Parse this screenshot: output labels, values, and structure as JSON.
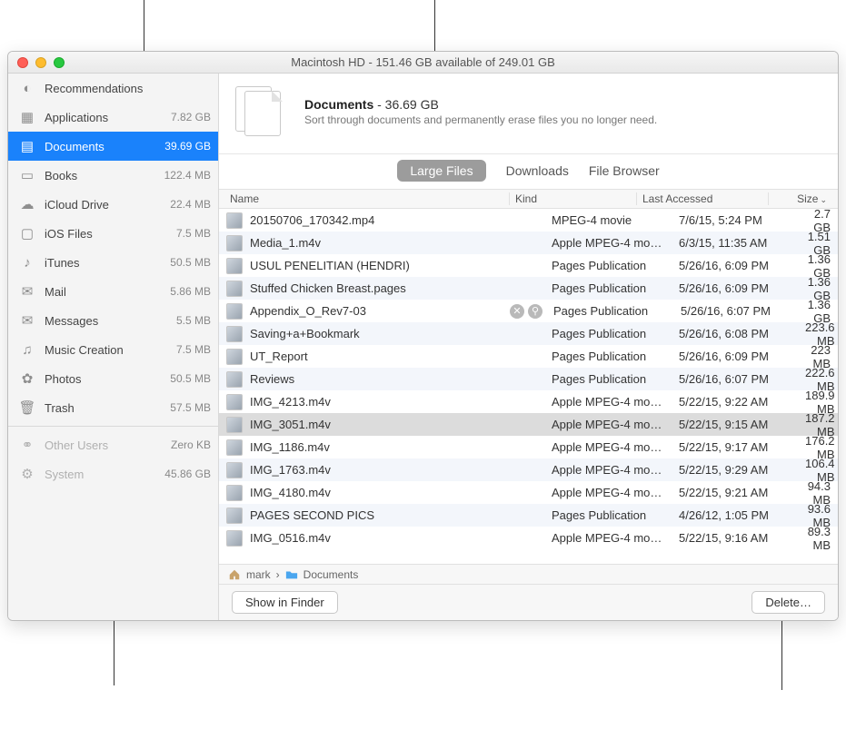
{
  "title": "Macintosh HD - 151.46 GB available of 249.01 GB",
  "sidebar": [
    {
      "icon": "lightbulb",
      "label": "Recommendations",
      "size": "",
      "dim": false
    },
    {
      "icon": "grid",
      "label": "Applications",
      "size": "7.82 GB"
    },
    {
      "icon": "doc",
      "label": "Documents",
      "size": "39.69 GB",
      "selected": true
    },
    {
      "icon": "book",
      "label": "Books",
      "size": "122.4 MB"
    },
    {
      "icon": "cloud",
      "label": "iCloud Drive",
      "size": "22.4 MB"
    },
    {
      "icon": "phone",
      "label": "iOS Files",
      "size": "7.5 MB"
    },
    {
      "icon": "note",
      "label": "iTunes",
      "size": "50.5 MB"
    },
    {
      "icon": "mail",
      "label": "Mail",
      "size": "5.86 MB"
    },
    {
      "icon": "bubble",
      "label": "Messages",
      "size": "5.5 MB"
    },
    {
      "icon": "music",
      "label": "Music Creation",
      "size": "7.5 MB"
    },
    {
      "icon": "flower",
      "label": "Photos",
      "size": "50.5 MB"
    },
    {
      "icon": "trash",
      "label": "Trash",
      "size": "57.5 MB"
    },
    {
      "sep": true
    },
    {
      "icon": "users",
      "label": "Other Users",
      "size": "Zero KB",
      "dim": true
    },
    {
      "icon": "gear",
      "label": "System",
      "size": "45.86 GB",
      "dim": true
    }
  ],
  "header": {
    "title_strong": "Documents",
    "title_rest": " - 36.69 GB",
    "subtitle": "Sort through documents and permanently erase files you no longer need."
  },
  "tabs": {
    "active": "Large Files",
    "t1": "Downloads",
    "t2": "File Browser"
  },
  "columns": {
    "name": "Name",
    "kind": "Kind",
    "date": "Last Accessed",
    "size": "Size"
  },
  "files": [
    {
      "name": "20150706_170342.mp4",
      "kind": "MPEG-4 movie",
      "date": "7/6/15, 5:24 PM",
      "size": "2.7 GB"
    },
    {
      "name": "Media_1.m4v",
      "kind": "Apple MPEG-4 mo…",
      "date": "6/3/15, 11:35 AM",
      "size": "1.51 GB"
    },
    {
      "name": "USUL PENELITIAN (HENDRI)",
      "kind": "Pages Publication",
      "date": "5/26/16, 6:09 PM",
      "size": "1.36 GB"
    },
    {
      "name": "Stuffed Chicken Breast.pages",
      "kind": "Pages Publication",
      "date": "5/26/16, 6:09 PM",
      "size": "1.36 GB"
    },
    {
      "name": "Appendix_O_Rev7-03",
      "kind": "Pages Publication",
      "date": "5/26/16, 6:07 PM",
      "size": "1.36 GB",
      "hover": true
    },
    {
      "name": "Saving+a+Bookmark",
      "kind": "Pages Publication",
      "date": "5/26/16, 6:08 PM",
      "size": "223.6 MB"
    },
    {
      "name": "UT_Report",
      "kind": "Pages Publication",
      "date": "5/26/16, 6:09 PM",
      "size": "223 MB"
    },
    {
      "name": "Reviews",
      "kind": "Pages Publication",
      "date": "5/26/16, 6:07 PM",
      "size": "222.6 MB"
    },
    {
      "name": "IMG_4213.m4v",
      "kind": "Apple MPEG-4 mo…",
      "date": "5/22/15, 9:22 AM",
      "size": "189.9 MB"
    },
    {
      "name": "IMG_3051.m4v",
      "kind": "Apple MPEG-4 mo…",
      "date": "5/22/15, 9:15 AM",
      "size": "187.2 MB",
      "selected": true
    },
    {
      "name": "IMG_1186.m4v",
      "kind": "Apple MPEG-4 mo…",
      "date": "5/22/15, 9:17 AM",
      "size": "176.2 MB"
    },
    {
      "name": "IMG_1763.m4v",
      "kind": "Apple MPEG-4 mo…",
      "date": "5/22/15, 9:29 AM",
      "size": "106.4 MB"
    },
    {
      "name": "IMG_4180.m4v",
      "kind": "Apple MPEG-4 mo…",
      "date": "5/22/15, 9:21 AM",
      "size": "94.3 MB"
    },
    {
      "name": "PAGES SECOND PICS",
      "kind": "Pages Publication",
      "date": "4/26/12, 1:05 PM",
      "size": "93.6 MB"
    },
    {
      "name": "IMG_0516.m4v",
      "kind": "Apple MPEG-4 mo…",
      "date": "5/22/15, 9:16 AM",
      "size": "89.3 MB"
    }
  ],
  "path": {
    "user": "mark",
    "folder": "Documents"
  },
  "footer": {
    "show": "Show in Finder",
    "delete": "Delete…"
  },
  "icons": {
    "lightbulb": "◐",
    "grid": "▦",
    "doc": "▤",
    "book": "▭",
    "cloud": "☁",
    "phone": "▢",
    "note": "♪",
    "mail": "✉",
    "bubble": "✉",
    "music": "♫",
    "flower": "✿",
    "trash": "🗑",
    "users": "⚭",
    "gear": "⚙"
  }
}
